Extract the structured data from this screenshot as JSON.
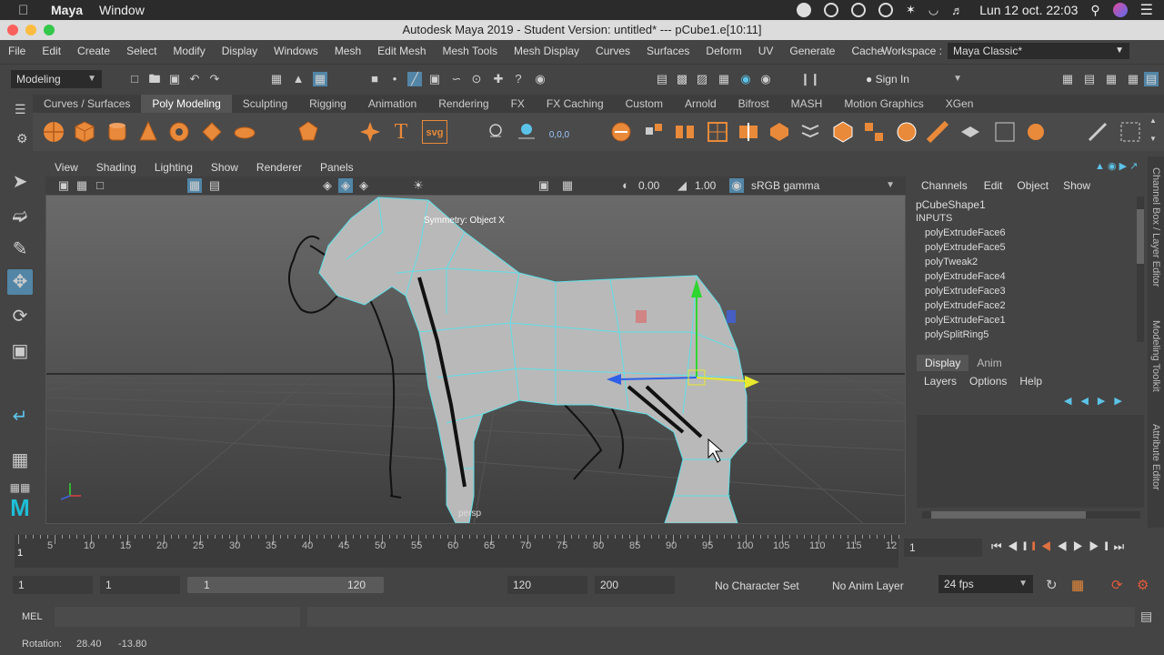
{
  "macbar": {
    "app": "Maya",
    "menus": [
      "Window"
    ],
    "datetime": "Lun 12 oct.  22:03"
  },
  "titlebar": {
    "title": "Autodesk Maya 2019 - Student Version: untitled*   ---   pCube1.e[10:11]"
  },
  "mainmenu": {
    "items": [
      "File",
      "Edit",
      "Create",
      "Select",
      "Modify",
      "Display",
      "Windows",
      "Mesh",
      "Edit Mesh",
      "Mesh Tools",
      "Mesh Display",
      "Curves",
      "Surfaces",
      "Deform",
      "UV",
      "Generate",
      "Cache"
    ],
    "workspace_label": "Workspace :",
    "workspace_value": "Maya Classic*"
  },
  "statusline": {
    "menuset": "Modeling",
    "sign_in": "Sign In"
  },
  "shelf": {
    "tabs": [
      "Curves / Surfaces",
      "Poly Modeling",
      "Sculpting",
      "Rigging",
      "Animation",
      "Rendering",
      "FX",
      "FX Caching",
      "Custom",
      "Arnold",
      "Bifrost",
      "MASH",
      "Motion Graphics",
      "XGen"
    ],
    "active_tab": "Poly Modeling",
    "svg_label": "svg",
    "coord_label": "0,0,0"
  },
  "viewport": {
    "menus": [
      "View",
      "Shading",
      "Lighting",
      "Show",
      "Renderer",
      "Panels"
    ],
    "exposure": "0.00",
    "gamma": "1.00",
    "colorspace": "sRGB gamma",
    "symmetry": "Symmetry: Object X",
    "camera": "persp"
  },
  "channelbox": {
    "menus": [
      "Channels",
      "Edit",
      "Object",
      "Show"
    ],
    "shape": "pCubeShape1",
    "inputs_label": "INPUTS",
    "inputs": [
      "polyExtrudeFace6",
      "polyExtrudeFace5",
      "polyTweak2",
      "polyExtrudeFace4",
      "polyExtrudeFace3",
      "polyExtrudeFace2",
      "polyExtrudeFace1",
      "polySplitRing5"
    ],
    "layer_tabs": [
      "Display",
      "Anim"
    ],
    "layer_menus": [
      "Layers",
      "Options",
      "Help"
    ]
  },
  "sidetabs": {
    "channel": "Channel Box / Layer Editor",
    "modeling": "Modeling Toolkit",
    "attribute": "Attribute Editor"
  },
  "timeslider": {
    "labels": [
      "5",
      "10",
      "15",
      "20",
      "25",
      "30",
      "35",
      "40",
      "45",
      "50",
      "55",
      "60",
      "65",
      "70",
      "75",
      "80",
      "85",
      "90",
      "95",
      "100",
      "105",
      "110",
      "115",
      "12"
    ],
    "current_frame_marker": "1",
    "current_frame": "1"
  },
  "range": {
    "start": "1",
    "playback_start": "1",
    "slider_start": "1",
    "slider_end": "120",
    "playback_end": "120",
    "end": "200",
    "character_set": "No Character Set",
    "anim_layer": "No Anim Layer",
    "fps": "24 fps"
  },
  "cmdline": {
    "label": "MEL"
  },
  "helpline": {
    "label": "Rotation:",
    "x": "28.40",
    "y": "-13.80"
  }
}
